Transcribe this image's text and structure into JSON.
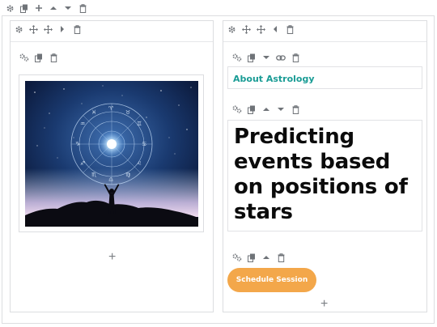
{
  "icons": {
    "settings": "gear-icon",
    "duplicate": "copy-icon",
    "add": "plus-icon",
    "move_up": "caret-up-icon",
    "move_down": "caret-down-icon",
    "delete": "trash-icon",
    "move": "move-arrows-icon",
    "link": "link-icon",
    "left": "caret-left-icon",
    "right": "caret-right-icon"
  },
  "right_column": {
    "kicker": "About Astrology",
    "headline": "Predicting events based on positions of stars",
    "button_label": "Schedule Session"
  },
  "add_glyph": "+",
  "colors": {
    "accent_teal": "#1a9c95",
    "button_orange": "#f3a74a",
    "toolbar_icon": "#6f7378",
    "border": "#dcdde0"
  }
}
